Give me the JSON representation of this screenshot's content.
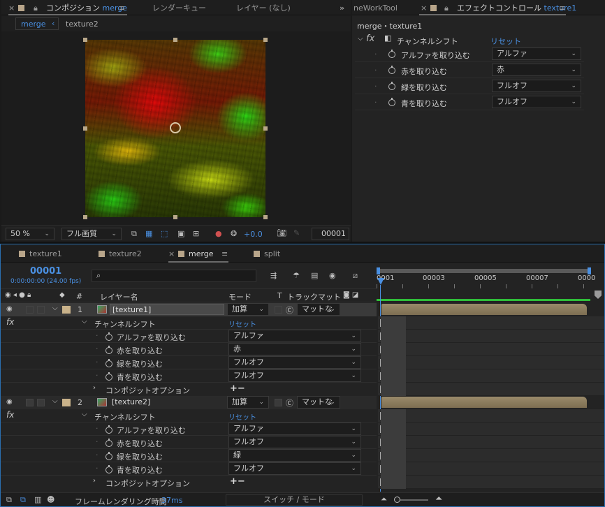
{
  "comp_panel": {
    "tabs": [
      "コンポジション",
      "merge",
      "レンダーキュー",
      "レイヤー (なし)"
    ],
    "breadcrumb": [
      "merge",
      "texture2"
    ],
    "zoom": "50 %",
    "quality": "フル画質",
    "exposure": "+0.0",
    "frame": "00001"
  },
  "effect_panel": {
    "left_tab": "neWorkTool",
    "tab": "エフェクトコントロール",
    "tab_layer": "texture1",
    "path": "merge・texture1",
    "effect_name": "チャンネルシフト",
    "reset": "リセット",
    "params": [
      {
        "label": "アルファを取り込む",
        "value": "アルファ"
      },
      {
        "label": "赤を取り込む",
        "value": "赤"
      },
      {
        "label": "緑を取り込む",
        "value": "フルオフ"
      },
      {
        "label": "青を取り込む",
        "value": "フルオフ"
      }
    ]
  },
  "timeline": {
    "tabs": [
      "texture1",
      "texture2",
      "merge",
      "split"
    ],
    "timecode": "00001",
    "timecode_sub": "0:00:00:00 (24.00 fps)",
    "search_placeholder": "",
    "headers": {
      "layer_name": "レイヤー名",
      "mode": "モード",
      "t": "T",
      "trackmatte": "トラックマット",
      "hash": "#"
    },
    "ruler": [
      "0001",
      "00003",
      "00005",
      "00007",
      "0000"
    ],
    "layers": [
      {
        "num": "1",
        "name": "[texture1]",
        "mode": "加算",
        "matte": "マットな",
        "effect": "チャンネルシフト",
        "reset": "リセット",
        "params": [
          {
            "label": "アルファを取り込む",
            "value": "アルファ"
          },
          {
            "label": "赤を取り込む",
            "value": "赤"
          },
          {
            "label": "緑を取り込む",
            "value": "フルオフ"
          },
          {
            "label": "青を取り込む",
            "value": "フルオフ"
          }
        ],
        "composite": "コンポジットオプション",
        "plusminus": "+−"
      },
      {
        "num": "2",
        "name": "[texture2]",
        "mode": "加算",
        "matte": "マットな",
        "effect": "チャンネルシフト",
        "reset": "リセット",
        "params": [
          {
            "label": "アルファを取り込む",
            "value": "アルファ"
          },
          {
            "label": "赤を取り込む",
            "value": "フルオフ"
          },
          {
            "label": "緑を取り込む",
            "value": "緑"
          },
          {
            "label": "青を取り込む",
            "value": "フルオフ"
          }
        ],
        "composite": "コンポジットオプション",
        "plusminus": "+−"
      }
    ],
    "footer": {
      "render_label": "フレームレンダリング時間",
      "render_time": "37ms",
      "switch_mode": "スイッチ / モード"
    }
  },
  "colors": {
    "accent": "#4a90e2",
    "layer_swatch": "#c9b28a",
    "green_bar": "#2fbf3a"
  },
  "icons": [
    "close-icon",
    "lock-icon",
    "menu-icon",
    "eye-icon",
    "stopwatch-icon",
    "fx-icon",
    "camera-icon"
  ]
}
